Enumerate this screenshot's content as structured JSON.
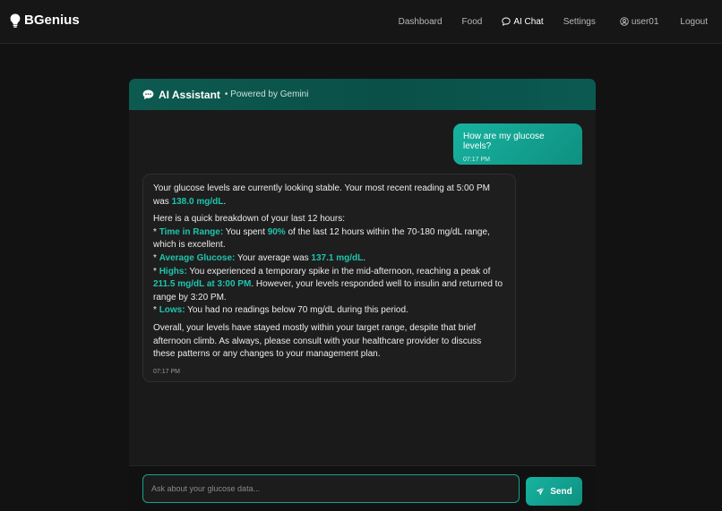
{
  "brand": {
    "name": "BGenius",
    "icon": "lightbulb-icon"
  },
  "nav": {
    "dashboard": "Dashboard",
    "food": "Food",
    "ai_chat": "AI Chat",
    "settings": "Settings",
    "user": "user01",
    "logout": "Logout"
  },
  "chat": {
    "title": "AI Assistant",
    "subtitle": "• Powered by Gemini",
    "user_message": {
      "text": "How are my glucose levels?",
      "time": "07:17 PM"
    },
    "ai_message": {
      "p1_a": "Your glucose levels are currently looking stable. Your most recent reading at 5:00 PM was ",
      "p1_hl": "138.0 mg/dL",
      "p1_b": ".",
      "intro": "Here is a quick breakdown of your last 12 hours:",
      "b1_label": "Time in Range:",
      "b1_a": " You spent ",
      "b1_hl": "90%",
      "b1_b": " of the last 12 hours within the 70-180 mg/dL range, which is excellent.",
      "b2_label": "Average Glucose:",
      "b2_a": " Your average was ",
      "b2_hl": "137.1 mg/dL",
      "b2_b": ".",
      "b3_label": "Highs:",
      "b3_a": " You experienced a temporary spike in the mid-afternoon, reaching a peak of ",
      "b3_hl": "211.5 mg/dL at 3:00 PM",
      "b3_b": ". However, your levels responded well to insulin and returned to range by 3:20 PM.",
      "b4_label": "Lows:",
      "b4_a": " You had no readings below 70 mg/dL during this period.",
      "outro": "Overall, your levels have stayed mostly within your target range, despite that brief afternoon climb. As always, please consult with your healthcare provider to discuss these patterns or any changes to your management plan.",
      "bullet": "*",
      "time": "07:17 PM"
    },
    "input_placeholder": "Ask about your glucose data...",
    "send_label": "Send"
  },
  "colors": {
    "accent": "#17b3a0",
    "header": "#0d5a50",
    "highlight": "#1ec4ae",
    "background": "#121212"
  }
}
